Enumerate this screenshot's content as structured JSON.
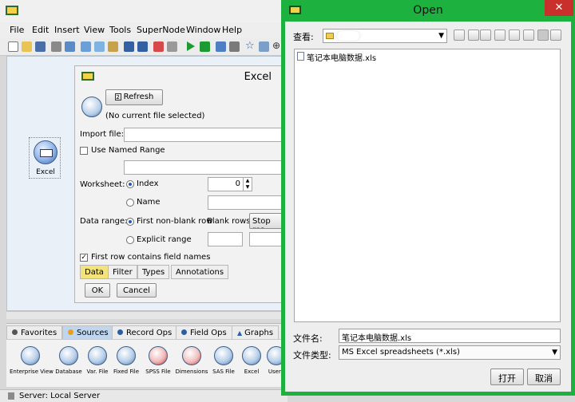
{
  "app": {
    "menu": [
      "File",
      "Edit",
      "Insert",
      "View",
      "Tools",
      "SuperNode",
      "Window",
      "Help"
    ]
  },
  "canvas": {
    "node_label": "Excel"
  },
  "excel_dialog": {
    "title": "Excel",
    "refresh_label": "Refresh",
    "no_file_text": "(No current file selected)",
    "import_file_label": "Import file:",
    "use_named_range_label": "Use Named Range",
    "worksheet_label": "Worksheet:",
    "index_label": "Index",
    "index_value": "0",
    "name_label": "Name",
    "data_range_label": "Data range:",
    "first_nonblank_label": "First non-blank row",
    "blank_rows_label": "Blank rows:",
    "stop_reading_label": "Stop rea",
    "explicit_range_label": "Explicit range",
    "first_row_names_label": "First row contains field names",
    "tabs": [
      "Data",
      "Filter",
      "Types",
      "Annotations"
    ],
    "ok_label": "OK",
    "cancel_label": "Cancel"
  },
  "palette": {
    "tabs": [
      "Favorites",
      "Sources",
      "Record Ops",
      "Field Ops",
      "Graphs"
    ],
    "nodes": [
      {
        "label": "Enterprise View",
        "badge": ""
      },
      {
        "label": "Database",
        "badge": "SQL"
      },
      {
        "label": "Var. File",
        "badge": ""
      },
      {
        "label": "Fixed File",
        "badge": ""
      },
      {
        "label": "SPSS File",
        "badge": "SPSS"
      },
      {
        "label": "Dimensions",
        "badge": ""
      },
      {
        "label": "SAS File",
        "badge": "SAS"
      },
      {
        "label": "Excel",
        "badge": "EXCEL"
      },
      {
        "label": "User I",
        "badge": ""
      }
    ]
  },
  "status": {
    "server_text": "Server: Local Server"
  },
  "open_dialog": {
    "title": "Open",
    "close_glyph": "✕",
    "look_in_label": "查看:",
    "file_item": "笔记本电脑数据.xls",
    "filename_label": "文件名:",
    "filename_value": "笔记本电脑数据.xls",
    "filetype_label": "文件类型:",
    "filetype_value": "MS Excel spreadsheets (*.xls)",
    "open_label": "打开",
    "cancel_label": "取消"
  },
  "colors": {
    "open_frame": "#1db23f",
    "active_tab": "#f4e27a",
    "palette_active_tab": "#bfd6ee"
  }
}
